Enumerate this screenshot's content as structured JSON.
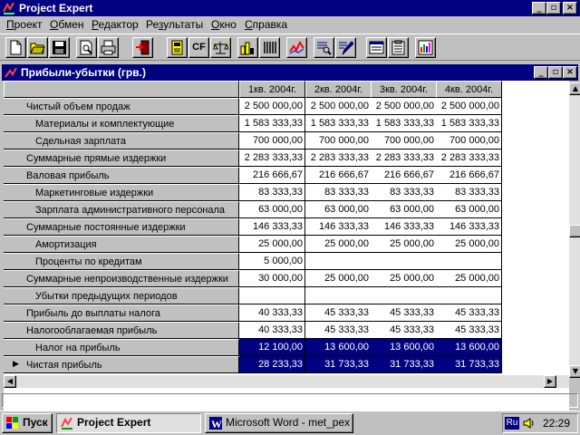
{
  "app": {
    "title": "Project Expert"
  },
  "menu": [
    {
      "label": "Проект",
      "key": "П",
      "rest": "роект"
    },
    {
      "label": "Обмен",
      "key": "О",
      "rest": "бмен"
    },
    {
      "label": "Редактор",
      "key": "Р",
      "rest": "едактор"
    },
    {
      "label": "Результаты",
      "key": "з",
      "pre": "Ре",
      "rest": "ультаты"
    },
    {
      "label": "Окно",
      "key": "О",
      "rest": "кно"
    },
    {
      "label": "Справка",
      "key": "С",
      "rest": "правка"
    }
  ],
  "toolbar": {
    "cf_label": "CF",
    "buttons": [
      "new-document",
      "open-folder",
      "save-disk",
      "print-preview",
      "printer",
      "exit-door",
      "calculator",
      "cash-flow",
      "balance-scales",
      "hatched-bars",
      "spiral-notebook",
      "line-chart",
      "search-report",
      "edit-pen",
      "window-list",
      "clipboard",
      "data-table"
    ]
  },
  "document": {
    "title": "Прибыли-убытки (грв.)",
    "columns": [
      "1кв. 2004г.",
      "2кв. 2004г.",
      "3кв. 2004г.",
      "4кв. 2004г."
    ],
    "rows": [
      {
        "label": "Чистый объем продаж",
        "indent": 0,
        "values": [
          "2 500 000,00",
          "2 500 000,00",
          "2 500 000,00",
          "2 500 000,00"
        ]
      },
      {
        "label": "Материалы и комплектующие",
        "indent": 1,
        "values": [
          "1 583 333,33",
          "1 583 333,33",
          "1 583 333,33",
          "1 583 333,33"
        ]
      },
      {
        "label": "Сдельная зарплата",
        "indent": 1,
        "values": [
          "700 000,00",
          "700 000,00",
          "700 000,00",
          "700 000,00"
        ]
      },
      {
        "label": "Суммарные прямые издержки",
        "indent": 0,
        "values": [
          "2 283 333,33",
          "2 283 333,33",
          "2 283 333,33",
          "2 283 333,33"
        ]
      },
      {
        "label": "Валовая прибыль",
        "indent": 0,
        "values": [
          "216 666,67",
          "216 666,67",
          "216 666,67",
          "216 666,67"
        ]
      },
      {
        "label": "Маркетинговые издержки",
        "indent": 1,
        "values": [
          "83 333,33",
          "83 333,33",
          "83 333,33",
          "83 333,33"
        ]
      },
      {
        "label": "Зарплата административного персонала",
        "indent": 1,
        "values": [
          "63 000,00",
          "63 000,00",
          "63 000,00",
          "63 000,00"
        ]
      },
      {
        "label": "Суммарные постоянные издержки",
        "indent": 0,
        "values": [
          "146 333,33",
          "146 333,33",
          "146 333,33",
          "146 333,33"
        ]
      },
      {
        "label": "Амортизация",
        "indent": 1,
        "values": [
          "25 000,00",
          "25 000,00",
          "25 000,00",
          "25 000,00"
        ]
      },
      {
        "label": "Проценты по кредитам",
        "indent": 1,
        "values": [
          "5 000,00",
          "",
          "",
          ""
        ]
      },
      {
        "label": "Суммарные непроизводственные издержки",
        "indent": 0,
        "values": [
          "30 000,00",
          "25 000,00",
          "25 000,00",
          "25 000,00"
        ]
      },
      {
        "label": "Убытки предыдущих периодов",
        "indent": 1,
        "values": [
          "",
          "",
          "",
          ""
        ]
      },
      {
        "label": "Прибыль до выплаты налога",
        "indent": 0,
        "values": [
          "40 333,33",
          "45 333,33",
          "45 333,33",
          "45 333,33"
        ]
      },
      {
        "label": "Налогооблагаемая прибыль",
        "indent": 0,
        "values": [
          "40 333,33",
          "45 333,33",
          "45 333,33",
          "45 333,33"
        ]
      },
      {
        "label": "Налог на прибыль",
        "indent": 1,
        "selected": true,
        "values": [
          "12 100,00",
          "13 600,00",
          "13 600,00",
          "13 600,00"
        ]
      },
      {
        "label": "Чистая прибыль",
        "indent": 0,
        "selected": true,
        "current": true,
        "values": [
          "28 233,33",
          "31 733,33",
          "31 733,33",
          "31 733,33"
        ]
      }
    ]
  },
  "taskbar": {
    "start_label": "Пуск",
    "tasks": [
      "Project Expert",
      "Microsoft Word - met_pex"
    ],
    "lang": "Ru",
    "clock": "22:29"
  },
  "colors": {
    "titlebar": "#000080",
    "face": "#c0c0c0",
    "selection": "#000080"
  }
}
